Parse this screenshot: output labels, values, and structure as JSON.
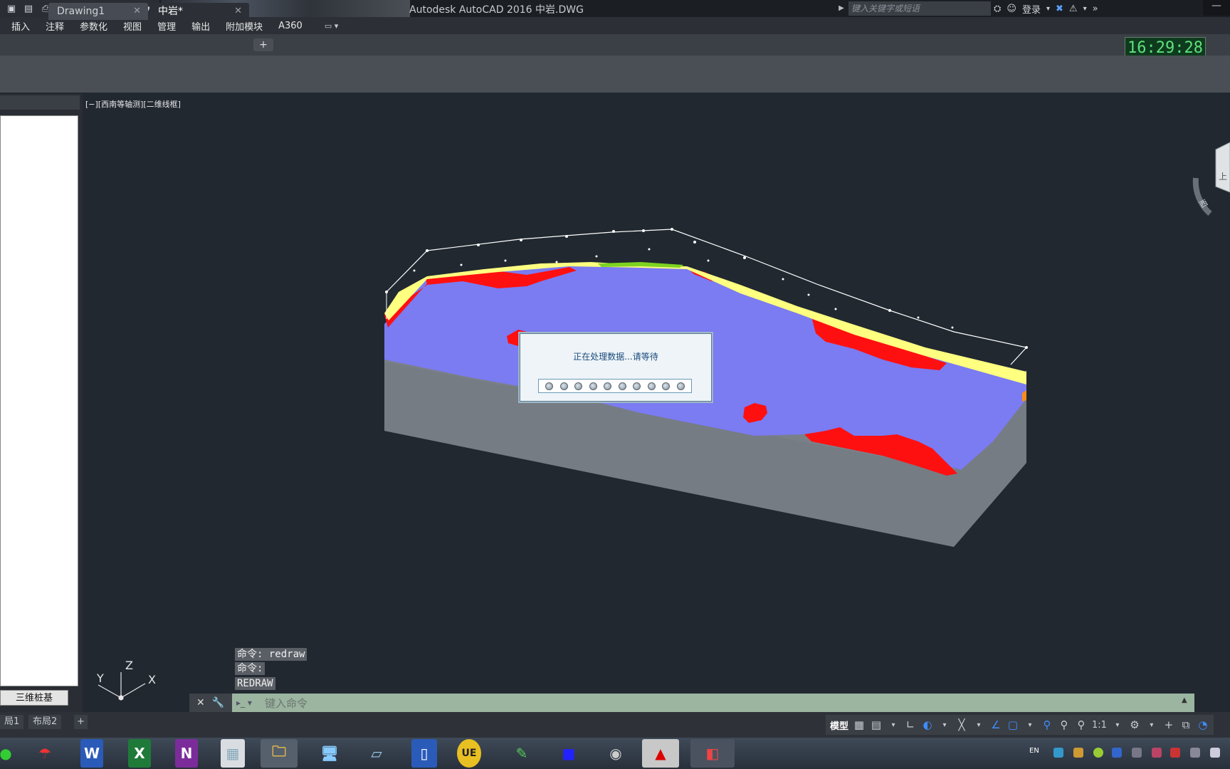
{
  "window": {
    "title": "Autodesk AutoCAD 2016    中岩.DWG",
    "search_placeholder": "键入关键字或短语",
    "login_label": "登录"
  },
  "menu": {
    "items": [
      "插入",
      "注释",
      "参数化",
      "视图",
      "管理",
      "输出",
      "附加模块",
      "A360"
    ]
  },
  "tabs": {
    "items": [
      {
        "label": "Drawing1"
      },
      {
        "label": "中岩*"
      }
    ],
    "add": "+"
  },
  "clock": "16:29:28",
  "viewport": {
    "label": "[−][西南等轴测][二维线框]",
    "ucs": {
      "x": "X",
      "y": "Y",
      "z": "Z"
    },
    "viewcube": {
      "face_top": "上",
      "face_side": "西"
    }
  },
  "palette": {
    "button_label": "三维桩基"
  },
  "dialog": {
    "message": "正在处理数据...请等待",
    "progress_dots": 10
  },
  "command": {
    "history": [
      "命令: redraw",
      "命令:",
      "REDRAW"
    ],
    "placeholder": "键入命令"
  },
  "layout_tabs": [
    "局1",
    "布局2"
  ],
  "status": {
    "model_label": "模型",
    "scale": "1:1"
  },
  "tray": {
    "lang": "EN"
  },
  "colors": {
    "background": "#212830",
    "layer_blue": "#7b7bf2",
    "layer_red": "#ff0000",
    "layer_yellow": "#ffff80",
    "layer_green": "#7ed321",
    "layer_gray": "#7a8088",
    "clock_text": "#5fe07d"
  }
}
